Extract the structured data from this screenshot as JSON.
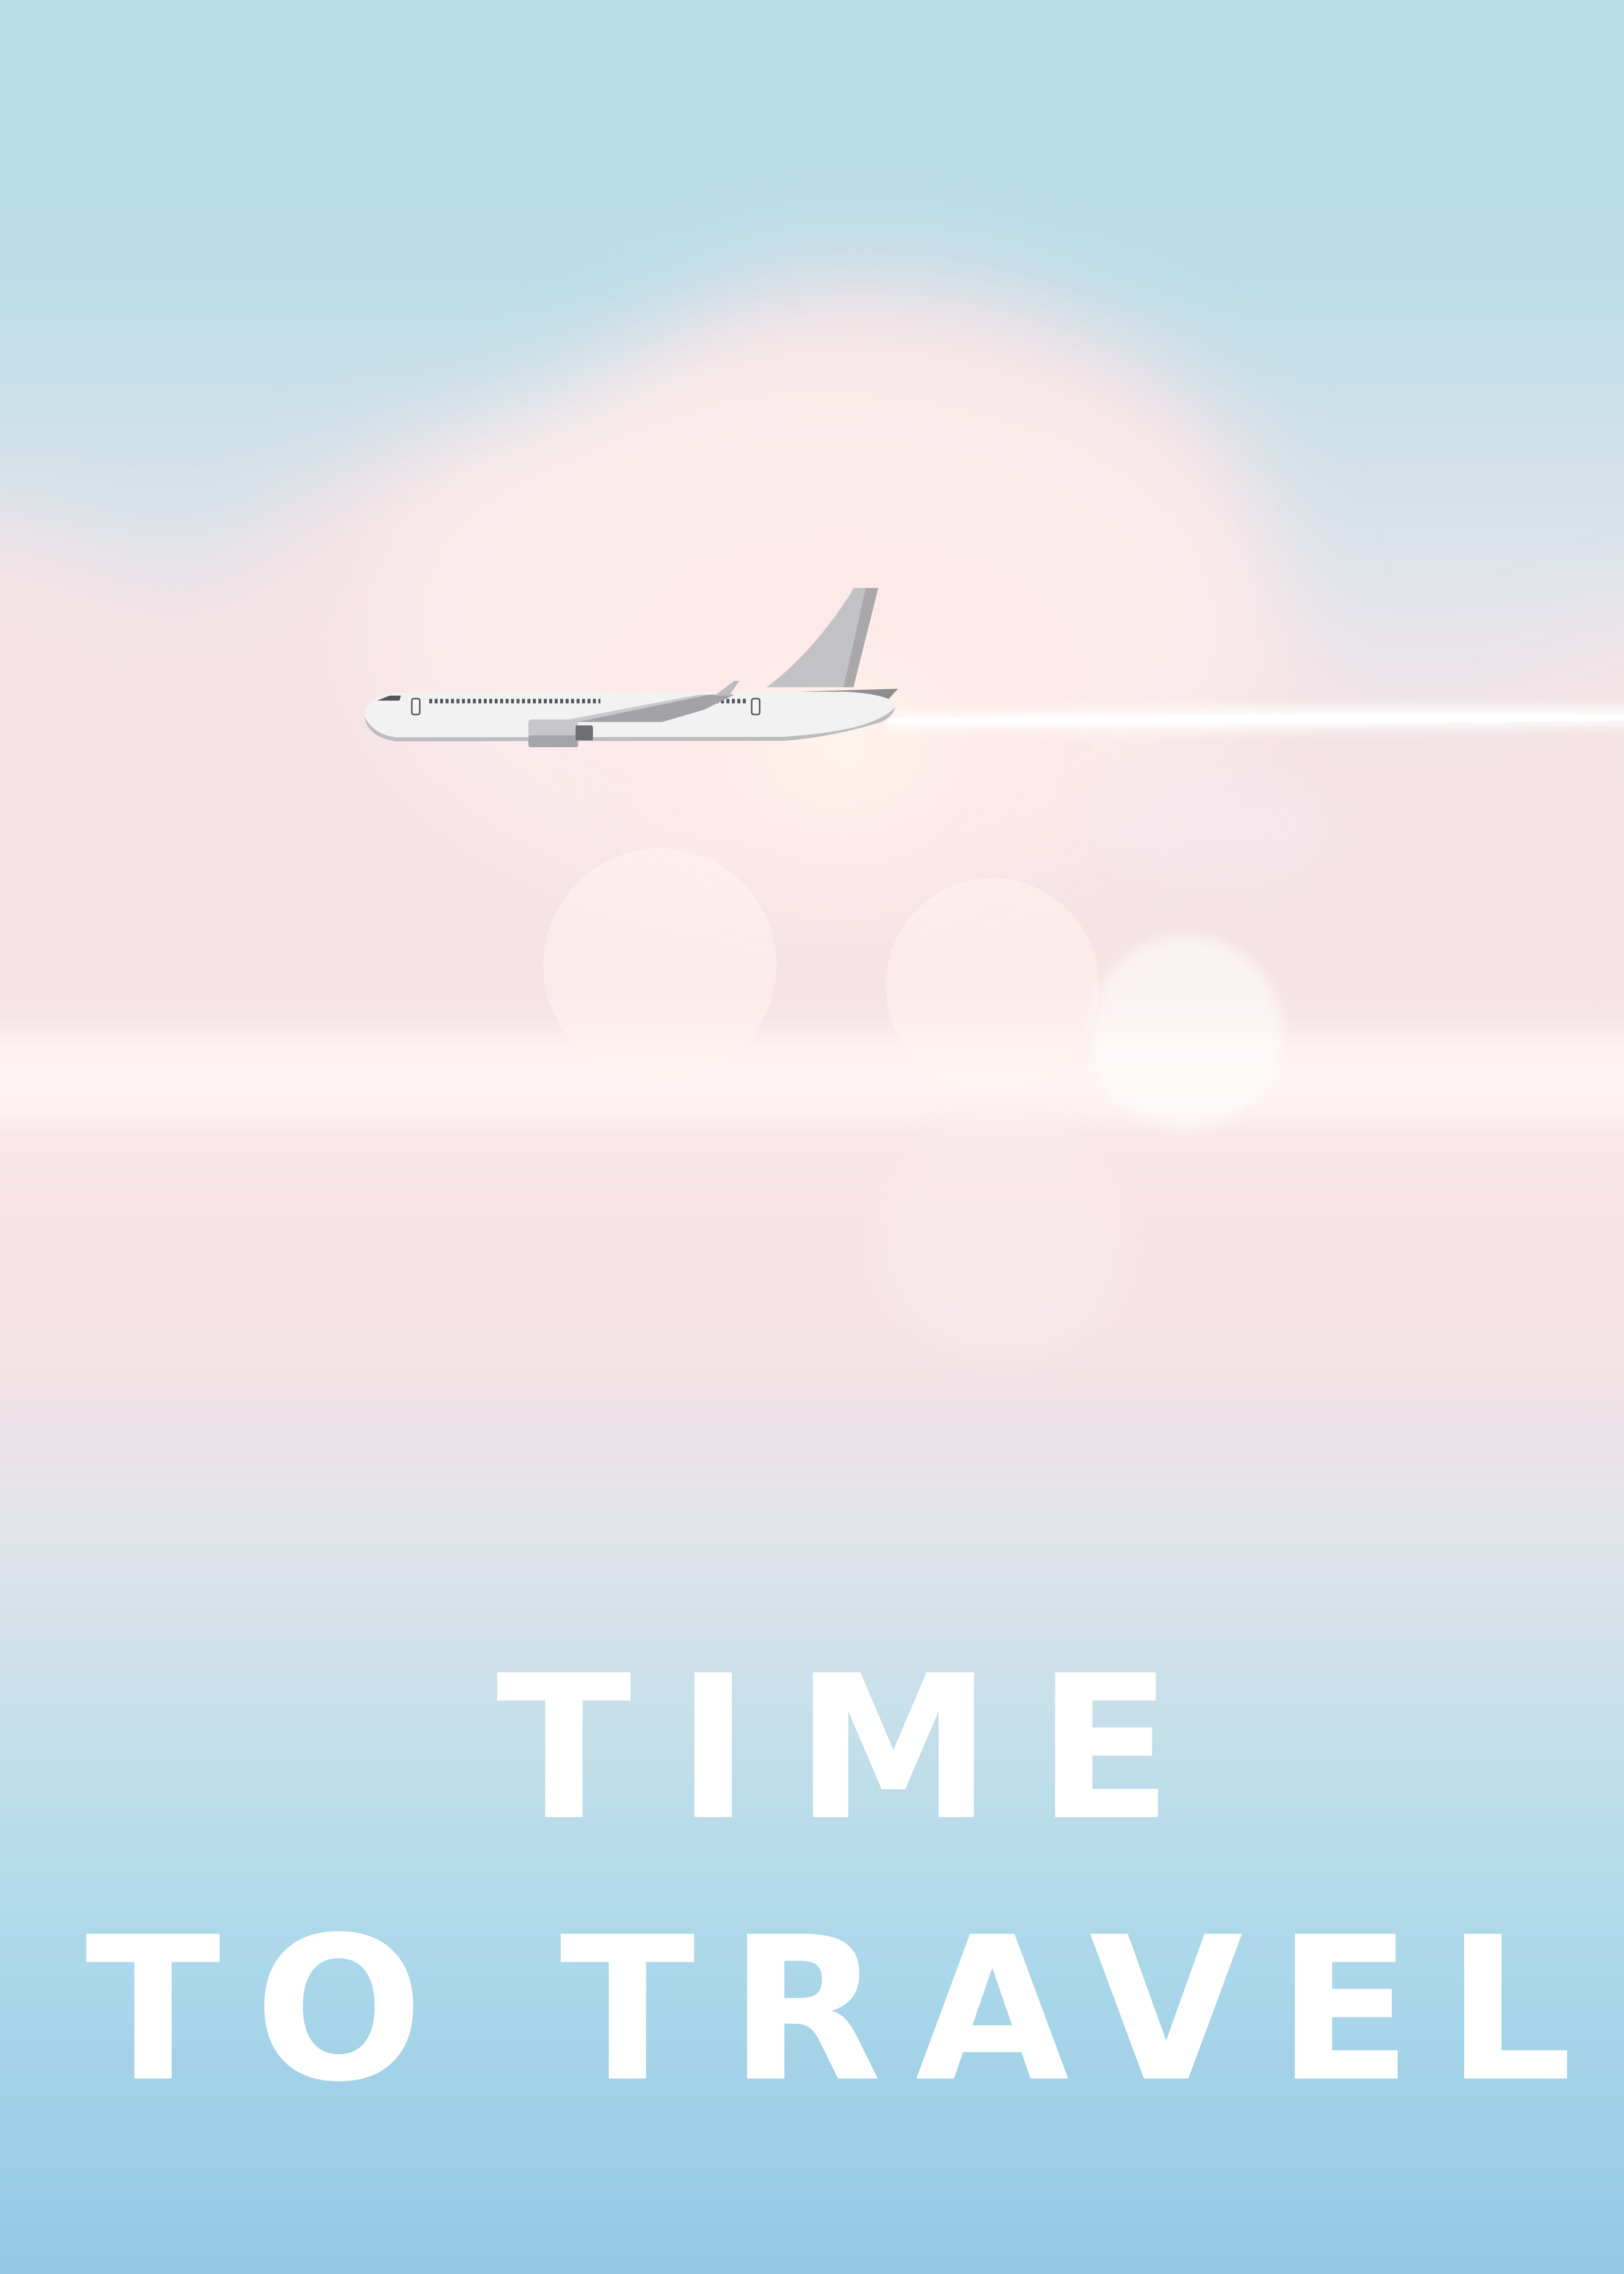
{
  "poster": {
    "headline_line_1": "TIME",
    "headline_line_2": "TO TRAVEL"
  },
  "icons": {
    "airplane": "airplane-icon",
    "contrail": "contrail-streak",
    "bokeh": "lens-flare-circles"
  },
  "colors": {
    "sky_top": "#b9dde9",
    "cloud_pink": "#f7e4e6",
    "sky_bottom": "#93c8e4",
    "text": "#ffffff",
    "plane_body": "#f2f2f2",
    "plane_shade": "#b8b8b8"
  }
}
